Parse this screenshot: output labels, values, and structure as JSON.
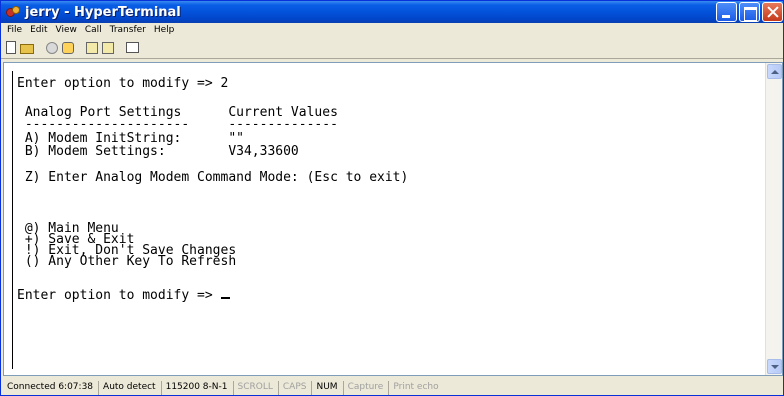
{
  "window": {
    "title": "jerry - HyperTerminal"
  },
  "menu": {
    "items": [
      "File",
      "Edit",
      "View",
      "Call",
      "Transfer",
      "Help"
    ]
  },
  "toolbar": {
    "icons": [
      "new-icon",
      "open-icon",
      "disconnect-icon",
      "dial-icon",
      "send-file-icon",
      "receive-file-icon",
      "properties-icon"
    ]
  },
  "terminal": {
    "lines": [
      "Enter option to modify => 2",
      " Analog Port Settings      Current Values",
      " ---------------------     --------------",
      " A) Modem InitString:      \"\"",
      " B) Modem Settings:        V34,33600",
      " Z) Enter Analog Modem Command Mode: (Esc to exit)",
      " @) Main Menu",
      " +) Save & Exit",
      " !) Exit, Don't Save Changes",
      " () Any Other Key To Refresh",
      "Enter option to modify => "
    ]
  },
  "status": {
    "connected": "Connected 6:07:38",
    "detect": "Auto detect",
    "settings": "115200 8-N-1",
    "scroll": "SCROLL",
    "caps": "CAPS",
    "num": "NUM",
    "capture": "Capture",
    "print_echo": "Print echo"
  }
}
